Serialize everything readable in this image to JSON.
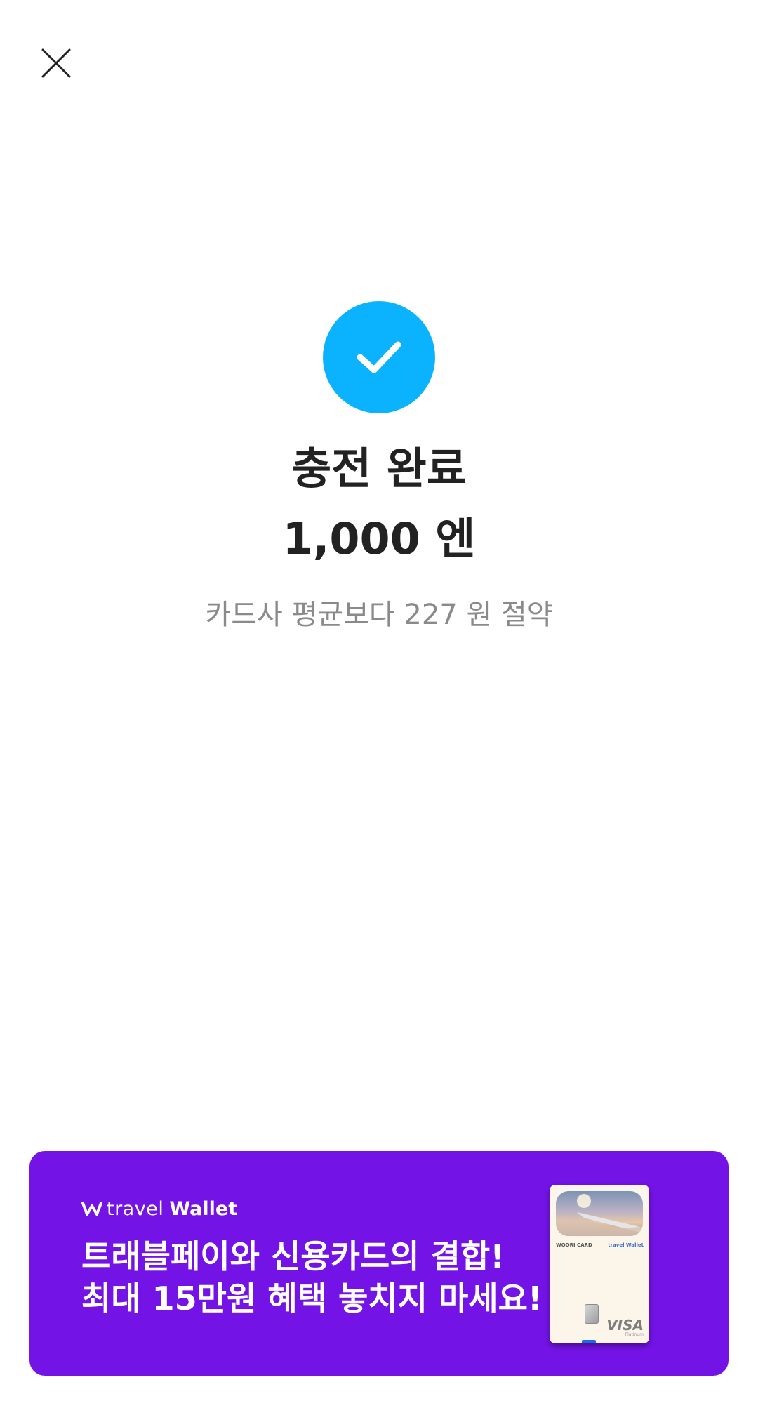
{
  "header": {
    "close_icon": "close-icon"
  },
  "result": {
    "status_icon": "check-icon",
    "status_color": "#0bb3ff",
    "title": "충전 완료",
    "amount": "1,000 엔",
    "saving_text": "카드사 평균보다 227 원 절약"
  },
  "promo": {
    "background": "#7313e6",
    "brand_travel": "travel",
    "brand_wallet": "Wallet",
    "line1": "트래블페이와 신용카드의 결합!",
    "line2": "최대 15만원 혜택 놓치지 마세요!",
    "card": {
      "issuer": "WOORI CARD",
      "brand": "travel Wallet",
      "network": "VISA",
      "tier": "Platinum"
    }
  }
}
